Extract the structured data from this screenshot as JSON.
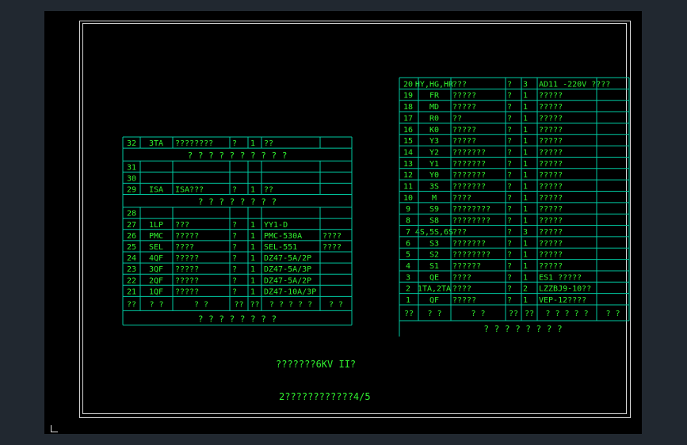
{
  "drawing": {
    "caption1": "???????6KV II?",
    "caption2": "2????????????4/5",
    "colors": {
      "line": "#00c8a0",
      "text": "#30f030",
      "background": "#000000",
      "frame": "#d8d8d8"
    }
  },
  "left_table": {
    "section1_title": "? ? ? ? ? ? ? ? ? ?",
    "section2_title": "? ? ? ? ? ? ? ?",
    "section3_title": "? ? ? ? ? ? ? ?",
    "rows_top": [
      [
        "32",
        "3TA",
        "????????",
        "?",
        "1",
        "??",
        ""
      ]
    ],
    "rows_mid": [
      [
        "31",
        "",
        "",
        "",
        "",
        "",
        ""
      ],
      [
        "30",
        "",
        "",
        "",
        "",
        "",
        ""
      ],
      [
        "29",
        "ISA",
        "ISA???",
        "?",
        "1",
        "??",
        ""
      ]
    ],
    "rows_bot": [
      [
        "28",
        "",
        "",
        "",
        "",
        "",
        ""
      ],
      [
        "27",
        "1LP",
        "???",
        "?",
        "1",
        "YY1-D",
        ""
      ],
      [
        "26",
        "PMC",
        "?????",
        "?",
        "1",
        "PMC-530A",
        "????"
      ],
      [
        "25",
        "SEL",
        "????",
        "?",
        "1",
        "SEL-551",
        "????"
      ],
      [
        "24",
        "4QF",
        "?????",
        "?",
        "1",
        "DZ47-5A/2P",
        ""
      ],
      [
        "23",
        "3QF",
        "?????",
        "?",
        "1",
        "DZ47-5A/3P",
        ""
      ],
      [
        "22",
        "2QF",
        "?????",
        "?",
        "1",
        "DZ47-5A/2P",
        ""
      ],
      [
        "21",
        "1QF",
        "?????",
        "?",
        "1",
        "DZ47-10A/3P",
        ""
      ]
    ],
    "header": [
      "??",
      "?  ?",
      "?   ?",
      "??",
      "??",
      "? ? ? ? ?",
      "?  ?"
    ]
  },
  "right_table": {
    "rows": [
      [
        "20",
        "HY,HG,HR",
        "???",
        "?",
        "3",
        "AD11 -220V ????",
        ""
      ],
      [
        "19",
        "FR",
        "?????",
        "?",
        "1",
        "?????",
        ""
      ],
      [
        "18",
        "MD",
        "?????",
        "?",
        "1",
        "?????",
        ""
      ],
      [
        "17",
        "R0",
        "??",
        "?",
        "1",
        "?????",
        ""
      ],
      [
        "16",
        "K0",
        "?????",
        "?",
        "1",
        "?????",
        ""
      ],
      [
        "15",
        "Y3",
        "?????",
        "?",
        "1",
        "?????",
        ""
      ],
      [
        "14",
        "Y2",
        "???????",
        "?",
        "1",
        "?????",
        ""
      ],
      [
        "13",
        "Y1",
        "???????",
        "?",
        "1",
        "?????",
        ""
      ],
      [
        "12",
        "Y0",
        "???????",
        "?",
        "1",
        "?????",
        ""
      ],
      [
        "11",
        "3S",
        "???????",
        "?",
        "1",
        "?????",
        ""
      ],
      [
        "10",
        "M",
        "????",
        "?",
        "1",
        "?????",
        ""
      ],
      [
        "9",
        "S9",
        "????????",
        "?",
        "1",
        "?????",
        ""
      ],
      [
        "8",
        "S8",
        "????????",
        "?",
        "1",
        "?????",
        ""
      ],
      [
        "7",
        "4S,5S,6S",
        "???",
        "?",
        "3",
        "?????",
        ""
      ],
      [
        "6",
        "S3",
        "???????",
        "?",
        "1",
        "?????",
        ""
      ],
      [
        "5",
        "S2",
        "????????",
        "?",
        "1",
        "?????",
        ""
      ],
      [
        "4",
        "S1",
        "??????",
        "?",
        "1",
        "?????",
        ""
      ],
      [
        "3",
        "QE",
        "????",
        "?",
        "1",
        "ES1   ?????",
        ""
      ],
      [
        "2",
        "1TA,2TA",
        "????",
        "?",
        "2",
        "LZZBJ9-10??",
        ""
      ],
      [
        "1",
        "QF",
        "?????",
        "?",
        "1",
        "VEP-12????",
        ""
      ]
    ],
    "header": [
      "??",
      "?  ?",
      "?   ?",
      "??",
      "??",
      "? ? ? ? ?",
      "?  ?"
    ],
    "title": "? ? ? ? ? ? ? ?"
  }
}
